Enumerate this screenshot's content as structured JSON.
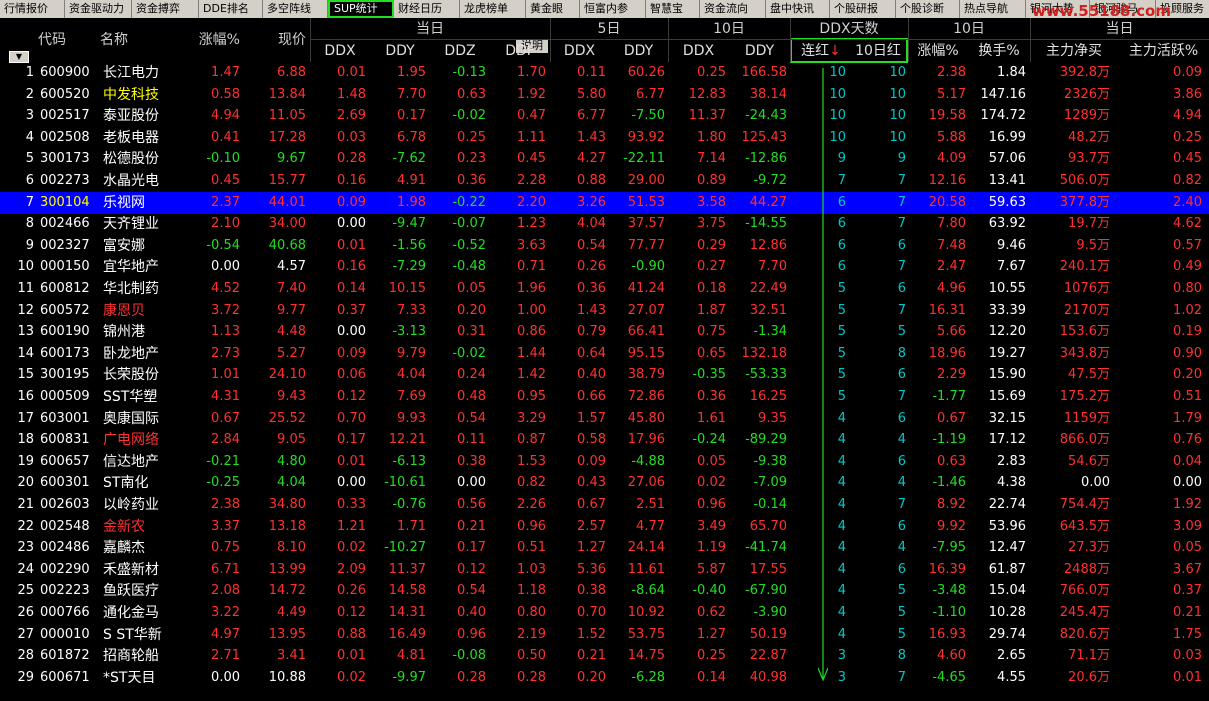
{
  "tabs": [
    "行情报价",
    "资金驱动力",
    "资金搏弈",
    "DDE排名",
    "多空阵线",
    "SUP统计",
    "财经日历",
    "龙虎榜单",
    "黄金眼",
    "恒富内参",
    "智慧宝",
    "资金流向",
    "盘中快讯",
    "个股研报",
    "个股诊断",
    "热点导航",
    "银河大势",
    "银河骏马",
    "投顾服务"
  ],
  "active_tab": "SUP统计",
  "watermark": "www.55188.com",
  "header": {
    "code": "代码",
    "name": "名称",
    "change_pct": "涨幅%",
    "price": "现价",
    "group_today": "当日",
    "explain": "说明",
    "group_5d": "5日",
    "group_10d": "10日",
    "group_ddx_days": "DDX天数",
    "group_10d_b": "10日",
    "group_today_b": "当日",
    "ddx": "DDX",
    "ddy": "DDY",
    "ddz": "DDZ",
    "ddf": "DDF",
    "consec_red": "连红",
    "consec_red_arrow": "↓",
    "red_10d": "10日红",
    "change_pct_b": "涨幅%",
    "turnover_pct": "换手%",
    "main_net_buy": "主力净买",
    "main_active_pct": "主力活跃%"
  },
  "selected_row": 7,
  "rows": [
    {
      "no": "1",
      "code": "600900",
      "name": "长江电力",
      "name_color": "white",
      "chg": "1.47",
      "price": "6.88",
      "ddx": "0.01",
      "ddy": "1.95",
      "ddz": "-0.13",
      "ddf": "1.70",
      "ddx5": "0.11",
      "ddy5": "60.26",
      "ddx10": "0.25",
      "ddy10": "166.58",
      "lh": "10",
      "h10": "10",
      "chg10": "2.38",
      "turn": "1.84",
      "net": "392.8万",
      "act": "0.09"
    },
    {
      "no": "2",
      "code": "600520",
      "name": "中发科技",
      "name_color": "yellow",
      "chg": "0.58",
      "price": "13.84",
      "ddx": "1.48",
      "ddy": "7.70",
      "ddz": "0.63",
      "ddf": "1.92",
      "ddx5": "5.80",
      "ddy5": "6.77",
      "ddx10": "12.83",
      "ddy10": "38.14",
      "lh": "10",
      "h10": "10",
      "chg10": "5.17",
      "turn": "147.16",
      "net": "2326万",
      "act": "3.86"
    },
    {
      "no": "3",
      "code": "002517",
      "name": "泰亚股份",
      "name_color": "white",
      "chg": "4.94",
      "price": "11.05",
      "ddx": "2.69",
      "ddy": "0.17",
      "ddz": "-0.02",
      "ddf": "0.47",
      "ddx5": "6.77",
      "ddy5": "-7.50",
      "ddx10": "11.37",
      "ddy10": "-24.43",
      "lh": "10",
      "h10": "10",
      "chg10": "19.58",
      "turn": "174.72",
      "net": "1289万",
      "act": "4.94"
    },
    {
      "no": "4",
      "code": "002508",
      "name": "老板电器",
      "name_color": "white",
      "chg": "0.41",
      "price": "17.28",
      "ddx": "0.03",
      "ddy": "6.78",
      "ddz": "0.25",
      "ddf": "1.11",
      "ddx5": "1.43",
      "ddy5": "93.92",
      "ddx10": "1.80",
      "ddy10": "125.43",
      "lh": "10",
      "h10": "10",
      "chg10": "5.88",
      "turn": "16.99",
      "net": "48.2万",
      "act": "0.25"
    },
    {
      "no": "5",
      "code": "300173",
      "name": "松德股份",
      "name_color": "white",
      "chg": "-0.10",
      "price": "9.67",
      "ddx": "0.28",
      "ddy": "-7.62",
      "ddz": "0.23",
      "ddf": "0.45",
      "ddx5": "4.27",
      "ddy5": "-22.11",
      "ddx10": "7.14",
      "ddy10": "-12.86",
      "lh": "9",
      "h10": "9",
      "chg10": "4.09",
      "turn": "57.06",
      "net": "93.7万",
      "act": "0.45"
    },
    {
      "no": "6",
      "code": "002273",
      "name": "水晶光电",
      "name_color": "white",
      "chg": "0.45",
      "price": "15.77",
      "ddx": "0.16",
      "ddy": "4.91",
      "ddz": "0.36",
      "ddf": "2.28",
      "ddx5": "0.88",
      "ddy5": "29.00",
      "ddx10": "0.89",
      "ddy10": "-9.72",
      "lh": "7",
      "h10": "7",
      "chg10": "12.16",
      "turn": "13.41",
      "net": "506.0万",
      "act": "0.82"
    },
    {
      "no": "7",
      "code": "300104",
      "name": "乐视网",
      "name_color": "white",
      "chg": "2.37",
      "price": "44.01",
      "ddx": "0.09",
      "ddy": "1.98",
      "ddz": "-0.22",
      "ddf": "2.20",
      "ddx5": "3.26",
      "ddy5": "51.53",
      "ddx10": "3.58",
      "ddy10": "44.27",
      "lh": "6",
      "h10": "7",
      "chg10": "20.58",
      "turn": "59.63",
      "net": "377.8万",
      "act": "2.40"
    },
    {
      "no": "8",
      "code": "002466",
      "name": "天齐锂业",
      "name_color": "white",
      "chg": "2.10",
      "price": "34.00",
      "ddx": "0.00",
      "ddy": "-9.47",
      "ddz": "-0.07",
      "ddf": "1.23",
      "ddx5": "4.04",
      "ddy5": "37.57",
      "ddx10": "3.75",
      "ddy10": "-14.55",
      "lh": "6",
      "h10": "7",
      "chg10": "7.80",
      "turn": "63.92",
      "net": "19.7万",
      "act": "4.62"
    },
    {
      "no": "9",
      "code": "002327",
      "name": "富安娜",
      "name_color": "white",
      "chg": "-0.54",
      "price": "40.68",
      "ddx": "0.01",
      "ddy": "-1.56",
      "ddz": "-0.52",
      "ddf": "3.63",
      "ddx5": "0.54",
      "ddy5": "77.77",
      "ddx10": "0.29",
      "ddy10": "12.86",
      "lh": "6",
      "h10": "6",
      "chg10": "7.48",
      "turn": "9.46",
      "net": "9.5万",
      "act": "0.57"
    },
    {
      "no": "10",
      "code": "000150",
      "name": "宜华地产",
      "name_color": "white",
      "chg": "0.00",
      "price": "4.57",
      "ddx": "0.16",
      "ddy": "-7.29",
      "ddz": "-0.48",
      "ddf": "0.71",
      "ddx5": "0.26",
      "ddy5": "-0.90",
      "ddx10": "0.27",
      "ddy10": "7.70",
      "lh": "6",
      "h10": "7",
      "chg10": "2.47",
      "turn": "7.67",
      "net": "240.1万",
      "act": "0.49"
    },
    {
      "no": "11",
      "code": "600812",
      "name": "华北制药",
      "name_color": "white",
      "chg": "4.52",
      "price": "7.40",
      "ddx": "0.14",
      "ddy": "10.15",
      "ddz": "0.05",
      "ddf": "1.96",
      "ddx5": "0.36",
      "ddy5": "41.24",
      "ddx10": "0.18",
      "ddy10": "22.49",
      "lh": "5",
      "h10": "6",
      "chg10": "4.96",
      "turn": "10.55",
      "net": "1076万",
      "act": "0.80"
    },
    {
      "no": "12",
      "code": "600572",
      "name": "康恩贝",
      "name_color": "red",
      "chg": "3.72",
      "price": "9.77",
      "ddx": "0.37",
      "ddy": "7.33",
      "ddz": "0.20",
      "ddf": "1.00",
      "ddx5": "1.43",
      "ddy5": "27.07",
      "ddx10": "1.87",
      "ddy10": "32.51",
      "lh": "5",
      "h10": "7",
      "chg10": "16.31",
      "turn": "33.39",
      "net": "2170万",
      "act": "1.02"
    },
    {
      "no": "13",
      "code": "600190",
      "name": "锦州港",
      "name_color": "white",
      "chg": "1.13",
      "price": "4.48",
      "ddx": "0.00",
      "ddy": "-3.13",
      "ddz": "0.31",
      "ddf": "0.86",
      "ddx5": "0.79",
      "ddy5": "66.41",
      "ddx10": "0.75",
      "ddy10": "-1.34",
      "lh": "5",
      "h10": "5",
      "chg10": "5.66",
      "turn": "12.20",
      "net": "153.6万",
      "act": "0.19"
    },
    {
      "no": "14",
      "code": "600173",
      "name": "卧龙地产",
      "name_color": "white",
      "chg": "2.73",
      "price": "5.27",
      "ddx": "0.09",
      "ddy": "9.79",
      "ddz": "-0.02",
      "ddf": "1.44",
      "ddx5": "0.64",
      "ddy5": "95.15",
      "ddx10": "0.65",
      "ddy10": "132.18",
      "lh": "5",
      "h10": "8",
      "chg10": "18.96",
      "turn": "19.27",
      "net": "343.8万",
      "act": "0.90"
    },
    {
      "no": "15",
      "code": "300195",
      "name": "长荣股份",
      "name_color": "white",
      "chg": "1.01",
      "price": "24.10",
      "ddx": "0.06",
      "ddy": "4.04",
      "ddz": "0.24",
      "ddf": "1.42",
      "ddx5": "0.40",
      "ddy5": "38.79",
      "ddx10": "-0.35",
      "ddy10": "-53.33",
      "lh": "5",
      "h10": "6",
      "chg10": "2.29",
      "turn": "15.90",
      "net": "47.5万",
      "act": "0.20"
    },
    {
      "no": "16",
      "code": "000509",
      "name": "SST华塑",
      "name_color": "white",
      "chg": "4.31",
      "price": "9.43",
      "ddx": "0.12",
      "ddy": "7.69",
      "ddz": "0.48",
      "ddf": "0.95",
      "ddx5": "0.66",
      "ddy5": "72.86",
      "ddx10": "0.36",
      "ddy10": "16.25",
      "lh": "5",
      "h10": "7",
      "chg10": "-1.77",
      "turn": "15.69",
      "net": "175.2万",
      "act": "0.51"
    },
    {
      "no": "17",
      "code": "603001",
      "name": "奥康国际",
      "name_color": "white",
      "chg": "0.67",
      "price": "25.52",
      "ddx": "0.70",
      "ddy": "9.93",
      "ddz": "0.54",
      "ddf": "3.29",
      "ddx5": "1.57",
      "ddy5": "45.80",
      "ddx10": "1.61",
      "ddy10": "9.35",
      "lh": "4",
      "h10": "6",
      "chg10": "0.67",
      "turn": "32.15",
      "net": "1159万",
      "act": "1.79"
    },
    {
      "no": "18",
      "code": "600831",
      "name": "广电网络",
      "name_color": "red",
      "chg": "2.84",
      "price": "9.05",
      "ddx": "0.17",
      "ddy": "12.21",
      "ddz": "0.11",
      "ddf": "0.87",
      "ddx5": "0.58",
      "ddy5": "17.96",
      "ddx10": "-0.24",
      "ddy10": "-89.29",
      "lh": "4",
      "h10": "4",
      "chg10": "-1.19",
      "turn": "17.12",
      "net": "866.0万",
      "act": "0.76"
    },
    {
      "no": "19",
      "code": "600657",
      "name": "信达地产",
      "name_color": "white",
      "chg": "-0.21",
      "price": "4.80",
      "ddx": "0.01",
      "ddy": "-6.13",
      "ddz": "0.38",
      "ddf": "1.53",
      "ddx5": "0.09",
      "ddy5": "-4.88",
      "ddx10": "0.05",
      "ddy10": "-9.38",
      "lh": "4",
      "h10": "6",
      "chg10": "0.63",
      "turn": "2.83",
      "net": "54.6万",
      "act": "0.04"
    },
    {
      "no": "20",
      "code": "600301",
      "name": "ST南化",
      "name_color": "white",
      "chg": "-0.25",
      "price": "4.04",
      "ddx": "0.00",
      "ddy": "-10.61",
      "ddz": "0.00",
      "ddf": "0.82",
      "ddx5": "0.43",
      "ddy5": "27.06",
      "ddx10": "0.02",
      "ddy10": "-7.09",
      "lh": "4",
      "h10": "4",
      "chg10": "-1.46",
      "turn": "4.38",
      "net": "0.00",
      "act": "0.00"
    },
    {
      "no": "21",
      "code": "002603",
      "name": "以岭药业",
      "name_color": "white",
      "chg": "2.38",
      "price": "34.80",
      "ddx": "0.33",
      "ddy": "-0.76",
      "ddz": "0.56",
      "ddf": "2.26",
      "ddx5": "0.67",
      "ddy5": "2.51",
      "ddx10": "0.96",
      "ddy10": "-0.14",
      "lh": "4",
      "h10": "7",
      "chg10": "8.92",
      "turn": "22.74",
      "net": "754.4万",
      "act": "1.92"
    },
    {
      "no": "22",
      "code": "002548",
      "name": "金新农",
      "name_color": "red",
      "chg": "3.37",
      "price": "13.18",
      "ddx": "1.21",
      "ddy": "1.71",
      "ddz": "0.21",
      "ddf": "0.96",
      "ddx5": "2.57",
      "ddy5": "4.77",
      "ddx10": "3.49",
      "ddy10": "65.70",
      "lh": "4",
      "h10": "6",
      "chg10": "9.92",
      "turn": "53.96",
      "net": "643.5万",
      "act": "3.09"
    },
    {
      "no": "23",
      "code": "002486",
      "name": "嘉麟杰",
      "name_color": "white",
      "chg": "0.75",
      "price": "8.10",
      "ddx": "0.02",
      "ddy": "-10.27",
      "ddz": "0.17",
      "ddf": "0.51",
      "ddx5": "1.27",
      "ddy5": "24.14",
      "ddx10": "1.19",
      "ddy10": "-41.74",
      "lh": "4",
      "h10": "4",
      "chg10": "-7.95",
      "turn": "12.47",
      "net": "27.3万",
      "act": "0.05"
    },
    {
      "no": "24",
      "code": "002290",
      "name": "禾盛新材",
      "name_color": "white",
      "chg": "6.71",
      "price": "13.99",
      "ddx": "2.09",
      "ddy": "11.37",
      "ddz": "0.12",
      "ddf": "1.03",
      "ddx5": "5.36",
      "ddy5": "11.61",
      "ddx10": "5.87",
      "ddy10": "17.55",
      "lh": "4",
      "h10": "6",
      "chg10": "16.39",
      "turn": "61.87",
      "net": "2488万",
      "act": "3.67"
    },
    {
      "no": "25",
      "code": "002223",
      "name": "鱼跃医疗",
      "name_color": "white",
      "chg": "2.08",
      "price": "14.72",
      "ddx": "0.26",
      "ddy": "14.58",
      "ddz": "0.54",
      "ddf": "1.18",
      "ddx5": "0.38",
      "ddy5": "-8.64",
      "ddx10": "-0.40",
      "ddy10": "-67.90",
      "lh": "4",
      "h10": "5",
      "chg10": "-3.48",
      "turn": "15.04",
      "net": "766.0万",
      "act": "0.37"
    },
    {
      "no": "26",
      "code": "000766",
      "name": "通化金马",
      "name_color": "white",
      "chg": "3.22",
      "price": "4.49",
      "ddx": "0.12",
      "ddy": "14.31",
      "ddz": "0.40",
      "ddf": "0.80",
      "ddx5": "0.70",
      "ddy5": "10.92",
      "ddx10": "0.62",
      "ddy10": "-3.90",
      "lh": "4",
      "h10": "5",
      "chg10": "-1.10",
      "turn": "10.28",
      "net": "245.4万",
      "act": "0.21"
    },
    {
      "no": "27",
      "code": "000010",
      "name": "S ST华新",
      "name_color": "white",
      "chg": "4.97",
      "price": "13.95",
      "ddx": "0.88",
      "ddy": "16.49",
      "ddz": "0.96",
      "ddf": "2.19",
      "ddx5": "1.52",
      "ddy5": "53.75",
      "ddx10": "1.27",
      "ddy10": "50.19",
      "lh": "4",
      "h10": "5",
      "chg10": "16.93",
      "turn": "29.74",
      "net": "820.6万",
      "act": "1.75"
    },
    {
      "no": "28",
      "code": "601872",
      "name": "招商轮船",
      "name_color": "white",
      "chg": "2.71",
      "price": "3.41",
      "ddx": "0.01",
      "ddy": "4.81",
      "ddz": "-0.08",
      "ddf": "0.50",
      "ddx5": "0.21",
      "ddy5": "14.75",
      "ddx10": "0.25",
      "ddy10": "22.87",
      "lh": "3",
      "h10": "8",
      "chg10": "4.60",
      "turn": "2.65",
      "net": "71.1万",
      "act": "0.03"
    },
    {
      "no": "29",
      "code": "600671",
      "name": "*ST天目",
      "name_color": "white",
      "chg": "0.00",
      "price": "10.88",
      "ddx": "0.02",
      "ddy": "-9.97",
      "ddz": "0.28",
      "ddf": "0.28",
      "ddx5": "0.20",
      "ddy5": "-6.28",
      "ddx10": "0.14",
      "ddy10": "40.98",
      "lh": "3",
      "h10": "7",
      "chg10": "-4.65",
      "turn": "4.55",
      "net": "20.6万",
      "act": "0.01"
    }
  ]
}
